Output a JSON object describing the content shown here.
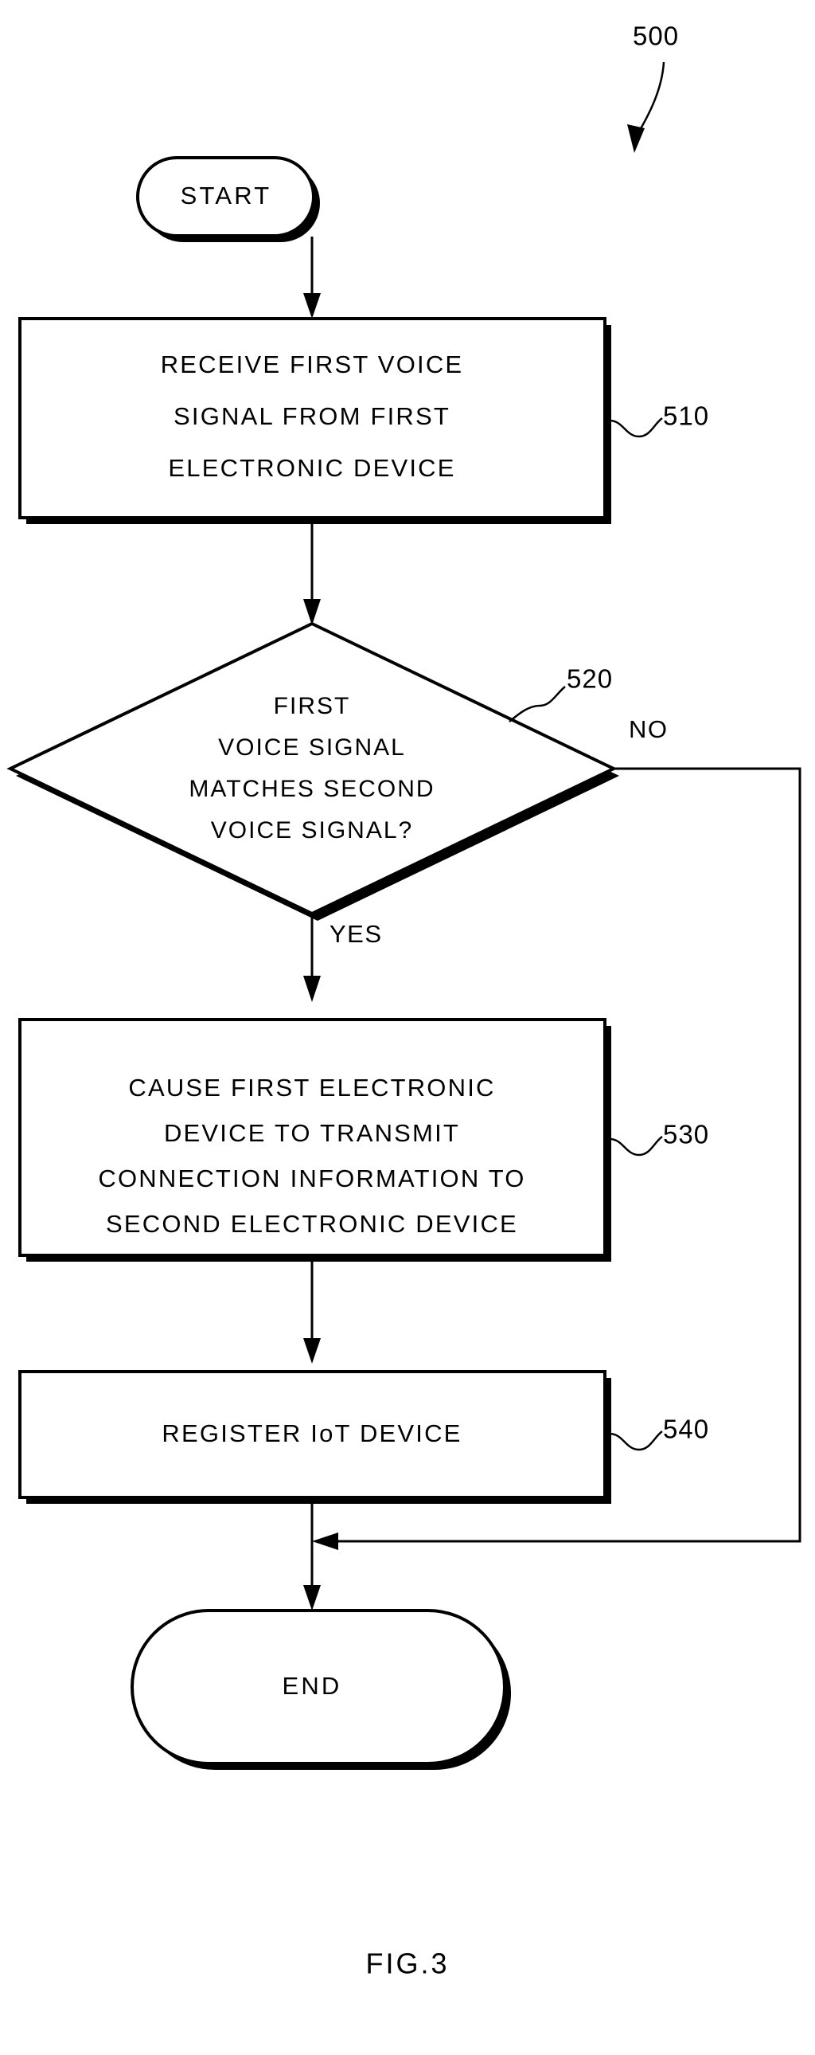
{
  "figure": {
    "caption": "FIG.3",
    "diagram_ref": "500",
    "type": "flowchart"
  },
  "nodes": [
    {
      "id": "start",
      "shape": "terminal",
      "label": "START",
      "ref": null
    },
    {
      "id": "step-510",
      "shape": "process",
      "ref": "510",
      "lines": [
        "RECEIVE FIRST VOICE",
        "SIGNAL FROM FIRST",
        "ELECTRONIC DEVICE"
      ]
    },
    {
      "id": "decision-520",
      "shape": "decision",
      "ref": "520",
      "lines": [
        "FIRST",
        "VOICE SIGNAL",
        "MATCHES SECOND",
        "VOICE SIGNAL?"
      ]
    },
    {
      "id": "step-530",
      "shape": "process",
      "ref": "530",
      "lines": [
        "CAUSE FIRST ELECTRONIC",
        "DEVICE TO TRANSMIT",
        "CONNECTION INFORMATION TO",
        "SECOND ELECTRONIC DEVICE"
      ]
    },
    {
      "id": "step-540",
      "shape": "process",
      "ref": "540",
      "lines": [
        "REGISTER IoT DEVICE"
      ]
    },
    {
      "id": "end",
      "shape": "terminal",
      "label": "END",
      "ref": null
    }
  ],
  "branches": {
    "yes_label": "YES",
    "no_label": "NO"
  },
  "colors": {
    "ink": "#000000",
    "paper": "#ffffff"
  }
}
